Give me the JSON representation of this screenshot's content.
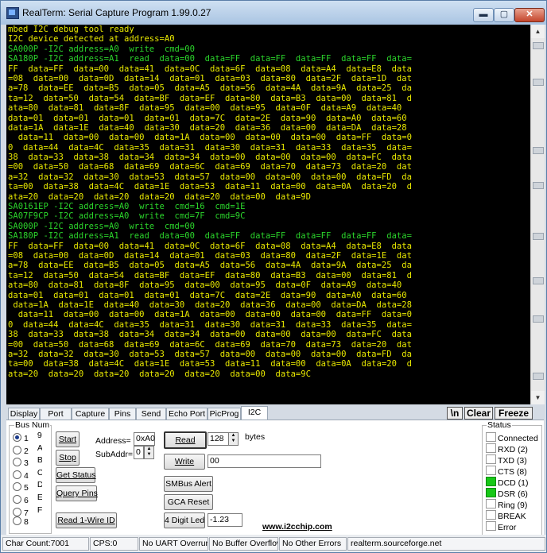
{
  "window": {
    "title": "RealTerm: Serial Capture Program 1.99.0.27",
    "min_glyph": "▬",
    "max_glyph": "▢",
    "close_glyph": "✕"
  },
  "terminal": {
    "text_color": "#e8e800",
    "highlight_color": "#2bd42b",
    "lines": [
      {
        "text": "mbed I2C debug tool ready",
        "green": false
      },
      {
        "text": "I2C device detected at address=A0",
        "green": false
      },
      {
        "text": "SA000P -I2C address=A0  write  cmd=00",
        "green": true
      },
      {
        "text": "SA180P -I2C address=A1  read  data=00  data=FF  data=FF  data=FF  data=FF  data=",
        "green": true
      },
      {
        "text": "FF  data=FF  data=00  data=41  data=0C  data=6F  data=08  data=A4  data=E8  data",
        "green": false
      },
      {
        "text": "=08  data=00  data=0D  data=14  data=01  data=03  data=80  data=2F  data=1D  dat",
        "green": false
      },
      {
        "text": "a=78  data=EE  data=B5  data=05  data=A5  data=56  data=4A  data=9A  data=25  da",
        "green": false
      },
      {
        "text": "ta=12  data=50  data=54  data=BF  data=EF  data=80  data=B3  data=00  data=81  d",
        "green": false
      },
      {
        "text": "ata=80  data=81  data=8F  data=95  data=00  data=95  data=0F  data=A9  data=40",
        "green": false
      },
      {
        "text": "data=01  data=01  data=01  data=01  data=7C  data=2E  data=90  data=A0  data=60",
        "green": false
      },
      {
        "text": "data=1A  data=1E  data=40  data=30  data=20  data=36  data=00  data=DA  data=28",
        "green": false
      },
      {
        "text": "  data=11  data=00  data=00  data=1A  data=00  data=00  data=00  data=FF  data=0",
        "green": false
      },
      {
        "text": "0  data=44  data=4C  data=35  data=31  data=30  data=31  data=33  data=35  data=",
        "green": false
      },
      {
        "text": "38  data=33  data=38  data=34  data=34  data=00  data=00  data=00  data=FC  data",
        "green": false
      },
      {
        "text": "=00  data=50  data=68  data=69  data=6C  data=69  data=70  data=73  data=20  dat",
        "green": false
      },
      {
        "text": "a=32  data=32  data=30  data=53  data=57  data=00  data=00  data=00  data=FD  da",
        "green": false
      },
      {
        "text": "ta=00  data=38  data=4C  data=1E  data=53  data=11  data=00  data=0A  data=20  d",
        "green": false
      },
      {
        "text": "ata=20  data=20  data=20  data=20  data=20  data=00  data=9D",
        "green": false
      },
      {
        "text": "SA0161EP -I2C address=A0  write  cmd=16  cmd=1E",
        "green": true
      },
      {
        "text": "SA07F9CP -I2C address=A0  write  cmd=7F  cmd=9C",
        "green": true
      },
      {
        "text": "SA000P -I2C address=A0  write  cmd=00",
        "green": true
      },
      {
        "text": "SA180P -I2C address=A1  read  data=00  data=FF  data=FF  data=FF  data=FF  data=",
        "green": true
      },
      {
        "text": "FF  data=FF  data=00  data=41  data=0C  data=6F  data=08  data=A4  data=E8  data",
        "green": false
      },
      {
        "text": "=08  data=00  data=0D  data=14  data=01  data=03  data=80  data=2F  data=1E  dat",
        "green": false
      },
      {
        "text": "a=78  data=EE  data=B5  data=05  data=A5  data=56  data=4A  data=9A  data=25  da",
        "green": false
      },
      {
        "text": "ta=12  data=50  data=54  data=BF  data=EF  data=80  data=B3  data=00  data=81  d",
        "green": false
      },
      {
        "text": "ata=80  data=81  data=8F  data=95  data=00  data=95  data=0F  data=A9  data=40",
        "green": false
      },
      {
        "text": "data=01  data=01  data=01  data=01  data=7C  data=2E  data=90  data=A0  data=60",
        "green": false
      },
      {
        "text": " data=1A  data=1E  data=40  data=30  data=20  data=36  data=00  data=DA  data=28",
        "green": false
      },
      {
        "text": "  data=11  data=00  data=00  data=1A  data=00  data=00  data=00  data=FF  data=0",
        "green": false
      },
      {
        "text": "0  data=44  data=4C  data=35  data=31  data=30  data=31  data=33  data=35  data=",
        "green": false
      },
      {
        "text": "38  data=33  data=38  data=34  data=34  data=00  data=00  data=00  data=FC  data",
        "green": false
      },
      {
        "text": "=00  data=50  data=68  data=69  data=6C  data=69  data=70  data=73  data=20  dat",
        "green": false
      },
      {
        "text": "a=32  data=32  data=30  data=53  data=57  data=00  data=00  data=00  data=FD  da",
        "green": false
      },
      {
        "text": "ta=00  data=38  data=4C  data=1E  data=53  data=11  data=00  data=0A  data=20  d",
        "green": false
      },
      {
        "text": "ata=20  data=20  data=20  data=20  data=20  data=00  data=9C",
        "green": false
      }
    ]
  },
  "tabs": [
    "Display",
    "Port",
    "Capture",
    "Pins",
    "Send",
    "Echo Port",
    "PicProg",
    "I2C"
  ],
  "active_tab": "I2C",
  "term_buttons": {
    "newline": "\\n",
    "clear": "Clear",
    "freeze": "Freeze"
  },
  "busnum": {
    "label": "Bus Num",
    "options": [
      {
        "num": "1",
        "letter": "9",
        "selected": true
      },
      {
        "num": "2",
        "letter": "A",
        "selected": false
      },
      {
        "num": "3",
        "letter": "B",
        "selected": false
      },
      {
        "num": "4",
        "letter": "C",
        "selected": false
      },
      {
        "num": "5",
        "letter": "D",
        "selected": false
      },
      {
        "num": "6",
        "letter": "E",
        "selected": false
      },
      {
        "num": "7",
        "letter": "F",
        "selected": false
      },
      {
        "num": "8",
        "letter": "",
        "selected": false
      }
    ]
  },
  "controls": {
    "start": "Start",
    "stop": "Stop",
    "get_status": "Get Status",
    "query_pins": "Query Pins",
    "read_1wire": "Read 1-Wire ID",
    "address_label": "Address=",
    "address_value": "0xA0",
    "subaddr_label": "SubAddr=",
    "subaddr_value": "0",
    "read": "Read",
    "read_count": "128",
    "bytes_label": "bytes",
    "write": "Write",
    "write_value": "00",
    "smbus_alert": "SMBus Alert",
    "gca_reset": "GCA Reset",
    "digit_led": "4 Digit Led",
    "digit_value": "-1.23"
  },
  "weblink": "www.i2cchip.com",
  "status": {
    "label": "Status",
    "led_on_color": "#17c817",
    "items": [
      {
        "name": "Connected",
        "on": false
      },
      {
        "name": "RXD (2)",
        "on": false
      },
      {
        "name": "TXD (3)",
        "on": false
      },
      {
        "name": "CTS (8)",
        "on": false
      },
      {
        "name": "DCD (1)",
        "on": true
      },
      {
        "name": "DSR (6)",
        "on": true
      },
      {
        "name": "Ring (9)",
        "on": false
      },
      {
        "name": "BREAK",
        "on": false
      },
      {
        "name": "Error",
        "on": false
      }
    ]
  },
  "statusbar": {
    "char_count": "Char Count:7001",
    "cps": "CPS:0",
    "uart": "No UART Overrun",
    "buffer": "No Buffer Overflow",
    "errors": "No Other Errors",
    "site": "realterm.sourceforge.net"
  }
}
